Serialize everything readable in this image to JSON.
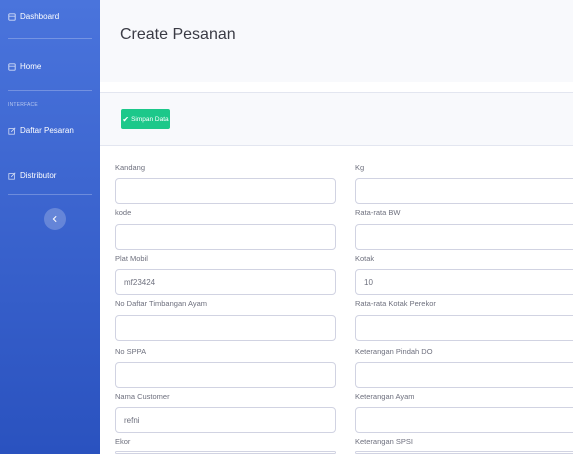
{
  "sidebar": {
    "items": [
      {
        "label": "Dashboard",
        "icon": "dashboard-icon"
      },
      {
        "label": "Home",
        "icon": "home-icon"
      }
    ],
    "section_heading": "INTERFACE",
    "interface_items": [
      {
        "label": "Daftar Pesaran",
        "icon": "edit-icon"
      },
      {
        "label": "Distributor",
        "icon": "edit-icon"
      }
    ],
    "toggle_icon": "chevron-left-icon"
  },
  "page": {
    "title": "Create Pesanan"
  },
  "toolbar": {
    "save_label": "Simpan Data",
    "save_icon": "check-icon"
  },
  "form": {
    "left": [
      {
        "label": "Kandang",
        "value": ""
      },
      {
        "label": "kode",
        "value": ""
      },
      {
        "label": "Plat Mobil",
        "value": "mf23424"
      },
      {
        "label": "No Daftar Timbangan Ayam",
        "value": ""
      },
      {
        "label": "No SPPA",
        "value": ""
      },
      {
        "label": "Nama Customer",
        "value": "refni"
      },
      {
        "label": "Ekor",
        "value": ""
      }
    ],
    "right": [
      {
        "label": "Kg",
        "value": ""
      },
      {
        "label": "Rata-rata BW",
        "value": ""
      },
      {
        "label": "Kotak",
        "value": "10"
      },
      {
        "label": "Rata-rata Kotak Perekor",
        "value": ""
      },
      {
        "label": "Keterangan Pindah DO",
        "value": ""
      },
      {
        "label": "Keterangan Ayam",
        "value": ""
      },
      {
        "label": "Keterangan SPSI",
        "value": ""
      }
    ]
  },
  "colors": {
    "sidebar": "#4a74dc",
    "success": "#1cc88a",
    "header_bg": "#f8f9fc"
  }
}
